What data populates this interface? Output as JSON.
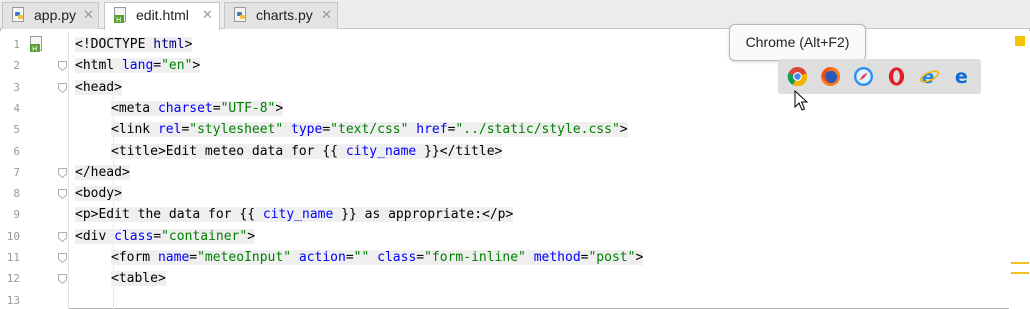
{
  "tabs": [
    {
      "label": "app.py",
      "active": false,
      "icon": "python-file-icon"
    },
    {
      "label": "edit.html",
      "active": true,
      "icon": "html-file-icon"
    },
    {
      "label": "charts.py",
      "active": false,
      "icon": "python-file-icon"
    }
  ],
  "tab_close_glyph": "✕",
  "line_numbers": [
    "1",
    "2",
    "3",
    "4",
    "5",
    "6",
    "7",
    "8",
    "9",
    "10",
    "11",
    "12",
    "13"
  ],
  "code_lines": [
    [
      "<!DOCTYPE ",
      "html",
      ">"
    ],
    [
      "<html ",
      "lang",
      "=",
      "\"en\"",
      ">"
    ],
    [
      "<head>"
    ],
    [
      "<meta ",
      "charset",
      "=",
      "\"UTF-8\"",
      ">"
    ],
    [
      "<link ",
      "rel",
      "=",
      "\"stylesheet\"",
      " ",
      "type",
      "=",
      "\"text/css\"",
      " ",
      "href",
      "=",
      "\"../static/style.css\"",
      ">"
    ],
    [
      "<title>",
      "Edit meteo data for {{ ",
      "city_name",
      " }}",
      "</title>"
    ],
    [
      "</head>"
    ],
    [
      "<body>"
    ],
    [
      "<p>",
      "Edit the data for {{ ",
      "city_name",
      " }} as appropriate:",
      "</p>"
    ],
    [
      "<div ",
      "class",
      "=",
      "\"container\"",
      ">"
    ],
    [
      "<form ",
      "name",
      "=",
      "\"meteoInput\"",
      " ",
      "action",
      "=",
      "\"\"",
      " ",
      "class",
      "=",
      "\"form-inline\"",
      " ",
      "method",
      "=",
      "\"post\"",
      ">"
    ],
    [
      "<table>"
    ],
    [
      ""
    ]
  ],
  "tooltip": "Chrome (Alt+F2)",
  "browser_icons": [
    "chrome-icon",
    "firefox-icon",
    "safari-icon",
    "opera-icon",
    "internet-explorer-icon",
    "edge-icon"
  ],
  "colors": {
    "tag": "#000080",
    "attribute": "#0000ff",
    "string": "#008000",
    "marker": "#f5c400"
  }
}
